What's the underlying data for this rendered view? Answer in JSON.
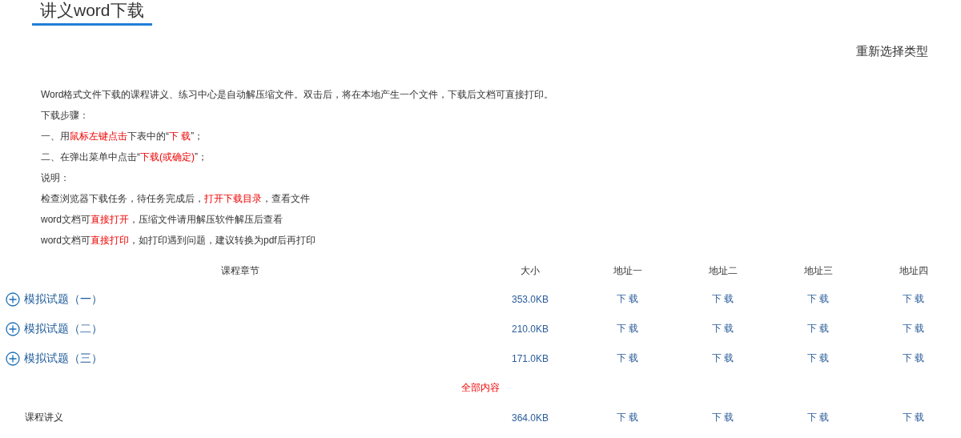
{
  "page_title": "讲义word下载",
  "reselect_link": "重新选择类型",
  "instructions": [
    [
      {
        "text": "Word格式文件下载的课程讲义、练习中心是自动解压缩文件。双击后，将在本地产生一个文件，下载后文档可直接打印。",
        "highlight": false
      }
    ],
    [
      {
        "text": "下载步骤：",
        "highlight": false
      }
    ],
    [
      {
        "text": "一、用",
        "highlight": false
      },
      {
        "text": "鼠标左键点击",
        "highlight": true
      },
      {
        "text": "下表中的“",
        "highlight": false
      },
      {
        "text": "下 载",
        "highlight": true
      },
      {
        "text": "”；",
        "highlight": false
      }
    ],
    [
      {
        "text": "二、在弹出菜单中点击“",
        "highlight": false
      },
      {
        "text": "下载(或确定)",
        "highlight": true
      },
      {
        "text": "”；",
        "highlight": false
      }
    ],
    [
      {
        "text": "说明：",
        "highlight": false
      }
    ],
    [
      {
        "text": "检查浏览器下载任务，待任务完成后，",
        "highlight": false
      },
      {
        "text": "打开下载目录",
        "highlight": true
      },
      {
        "text": "，查看文件",
        "highlight": false
      }
    ],
    [
      {
        "text": "word文档可",
        "highlight": false
      },
      {
        "text": "直接打开",
        "highlight": true
      },
      {
        "text": "，压缩文件请用解压软件解压后查看",
        "highlight": false
      }
    ],
    [
      {
        "text": "word文档可",
        "highlight": false
      },
      {
        "text": "直接打印",
        "highlight": true
      },
      {
        "text": "，如打印遇到问题，建议转换为pdf后再打印",
        "highlight": false
      }
    ]
  ],
  "table": {
    "columns": [
      "课程章节",
      "大小",
      "地址一",
      "地址二",
      "地址三",
      "地址四"
    ],
    "rows": [
      {
        "kind": "chapter",
        "name": "模拟试题（一）",
        "size": "353.0KB",
        "links": [
          "下 载",
          "下 载",
          "下 载",
          "下 载"
        ]
      },
      {
        "kind": "chapter",
        "name": "模拟试题（二）",
        "size": "210.0KB",
        "links": [
          "下 载",
          "下 载",
          "下 载",
          "下 载"
        ]
      },
      {
        "kind": "chapter",
        "name": "模拟试题（三）",
        "size": "171.0KB",
        "links": [
          "下 载",
          "下 载",
          "下 载",
          "下 载"
        ]
      },
      {
        "kind": "section",
        "name": "全部内容"
      },
      {
        "kind": "item",
        "name": "课程讲义",
        "size": "364.0KB",
        "links": [
          "下 载",
          "下 载",
          "下 载",
          "下 载"
        ]
      }
    ]
  }
}
